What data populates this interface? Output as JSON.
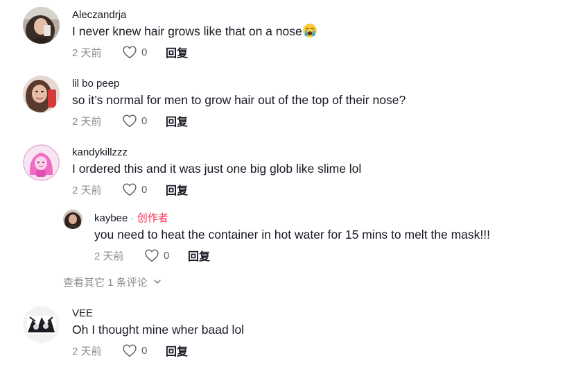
{
  "comments": [
    {
      "username": "Aleczandrja",
      "text": "I never knew hair grows like that on a nose",
      "emoji": "crying-face-emoji",
      "time": "2 天前",
      "likes": "0",
      "reply": "回复"
    },
    {
      "username": "lil bo peep",
      "text": "so it’s normal for men to grow hair out of the top of their nose?",
      "time": "2 天前",
      "likes": "0",
      "reply": "回复"
    },
    {
      "username": "kandykillzzz",
      "text": "I ordered this and it was just one big glob like slime lol",
      "time": "2 天前",
      "likes": "0",
      "reply": "回复"
    },
    {
      "username": "VEE",
      "text": "Oh I thought mine wher baad lol",
      "time": "2 天前",
      "likes": "0",
      "reply": "回复"
    }
  ],
  "reply_comment": {
    "username": "kaybee",
    "separator": "·",
    "creator_tag": "创作者",
    "text": "you need to heat the container in hot water for 15 mins to melt the mask!!!",
    "time": "2 天前",
    "likes": "0",
    "reply": "回复"
  },
  "view_more": {
    "label": "查看其它 1 条评论",
    "icon": "chevron-down-icon"
  },
  "icons": {
    "like": "heart-outline-icon",
    "expand": "chevron-down-icon"
  },
  "colors": {
    "text_primary": "#161823",
    "text_secondary": "#8a8b91",
    "creator_accent": "#fe2c55"
  }
}
